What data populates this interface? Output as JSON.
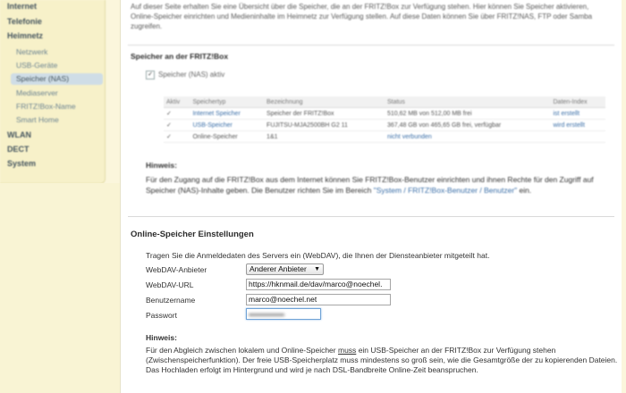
{
  "sidebar": {
    "items": [
      {
        "label": "Internet",
        "level": "top"
      },
      {
        "label": "Telefonie",
        "level": "top"
      },
      {
        "label": "Heimnetz",
        "level": "top"
      },
      {
        "label": "Netzwerk",
        "level": "sub"
      },
      {
        "label": "USB-Geräte",
        "level": "sub"
      },
      {
        "label": "Speicher (NAS)",
        "level": "sub",
        "active": true
      },
      {
        "label": "Mediaserver",
        "level": "sub"
      },
      {
        "label": "FRITZ!Box-Name",
        "level": "sub"
      },
      {
        "label": "Smart Home",
        "level": "sub"
      },
      {
        "label": "WLAN",
        "level": "top"
      },
      {
        "label": "DECT",
        "level": "top"
      },
      {
        "label": "System",
        "level": "top"
      }
    ]
  },
  "intro": {
    "text": "Auf dieser Seite erhalten Sie eine Übersicht über die Speicher, die an der FRITZ!Box zur Verfügung stehen. Hier können Sie Speicher aktivieren, Online-Speicher einrichten und Medieninhalte im Heimnetz zur Verfügung stellen. Auf diese Daten können Sie über FRITZ!NAS, FTP oder Samba zugreifen."
  },
  "nas_section": {
    "title": "Speicher an der FRITZ!Box",
    "checkbox_label": "Speicher (NAS) aktiv",
    "table": {
      "headers": [
        "Aktiv",
        "Speichertyp",
        "Bezeichnung",
        "Status",
        "Daten-Index"
      ],
      "rows": [
        {
          "active": "✓",
          "type": "Internet Speicher",
          "name": "Speicher der FRITZ!Box",
          "status": "510,62 MB von 512,00 MB frei",
          "index": "ist erstellt"
        },
        {
          "active": "✓",
          "type": "USB-Speicher",
          "name": "FUJITSU-MJA2500BH G2 11",
          "status": "367,48 GB von 465,65 GB frei, verfügbar",
          "index": "wird erstellt"
        },
        {
          "active": "✓",
          "type": "Online-Speicher",
          "name": "1&1",
          "status": "nicht verbunden",
          "index": ""
        }
      ]
    },
    "hint_title": "Hinweis:",
    "hint_text": "Für den Zugang auf die FRITZ!Box aus dem Internet können Sie FRITZ!Box-Benutzer einrichten und ihnen Rechte für den Zugriff auf Speicher (NAS)-Inhalte geben. Die Benutzer richten Sie im Bereich",
    "hint_link": "\"System / FRITZ!Box-Benutzer / Benutzer\"",
    "hint_suffix": "ein."
  },
  "online_section": {
    "title": "Online-Speicher Einstellungen",
    "intro": "Tragen Sie die Anmeldedaten des Servers ein (WebDAV), die Ihnen der Diensteanbieter mitgeteilt hat.",
    "fields": {
      "provider_label": "WebDAV-Anbieter",
      "provider_value": "Anderer Anbieter",
      "url_label": "WebDAV-URL",
      "url_value": "https://hknmail.de/dav/marco@noechel.",
      "user_label": "Benutzername",
      "user_value": "marco@noechel.net",
      "password_label": "Passwort"
    },
    "hint_title": "Hinweis:",
    "hint_text_1": "Für den Abgleich zwischen lokalem und Online-Speicher",
    "hint_text_must": "muss",
    "hint_text_2": "ein USB-Speicher an der FRITZ!Box zur Verfügung stehen (Zwischenspeicherfunktion). Der freie USB-Speicherplatz muss mindestens so groß sein, wie die Gesamtgröße der zu kopierenden Dateien. Das Hochladen erfolgt im Hintergrund und wird je nach DSL-Bandbreite Online-Zeit beanspruchen."
  },
  "icons": {
    "dropdown": "caret-down-icon",
    "check": "checkmark-icon"
  }
}
